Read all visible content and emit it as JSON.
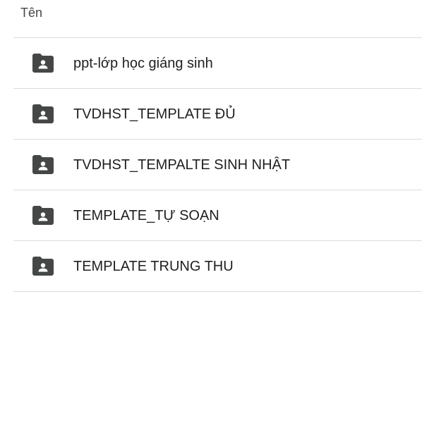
{
  "header": {
    "name_column_label": "Tên"
  },
  "folders": [
    {
      "name": "ppt-lớp học giáng sinh",
      "icon": "shared-folder-icon"
    },
    {
      "name": "TVDHST_TEMPLATE ĐỦ",
      "icon": "shared-folder-icon"
    },
    {
      "name": "TVDHST_TEMPALTE SINH NHẬT",
      "icon": "shared-folder-icon"
    },
    {
      "name": "TEMPLATE_TỰ SOẠN",
      "icon": "shared-folder-icon"
    },
    {
      "name": "TEMPLATE TRUNG THU",
      "icon": "shared-folder-icon"
    }
  ],
  "colors": {
    "folder_icon": "#444746",
    "text": "#1f1f1f",
    "divider": "#dadce0"
  }
}
